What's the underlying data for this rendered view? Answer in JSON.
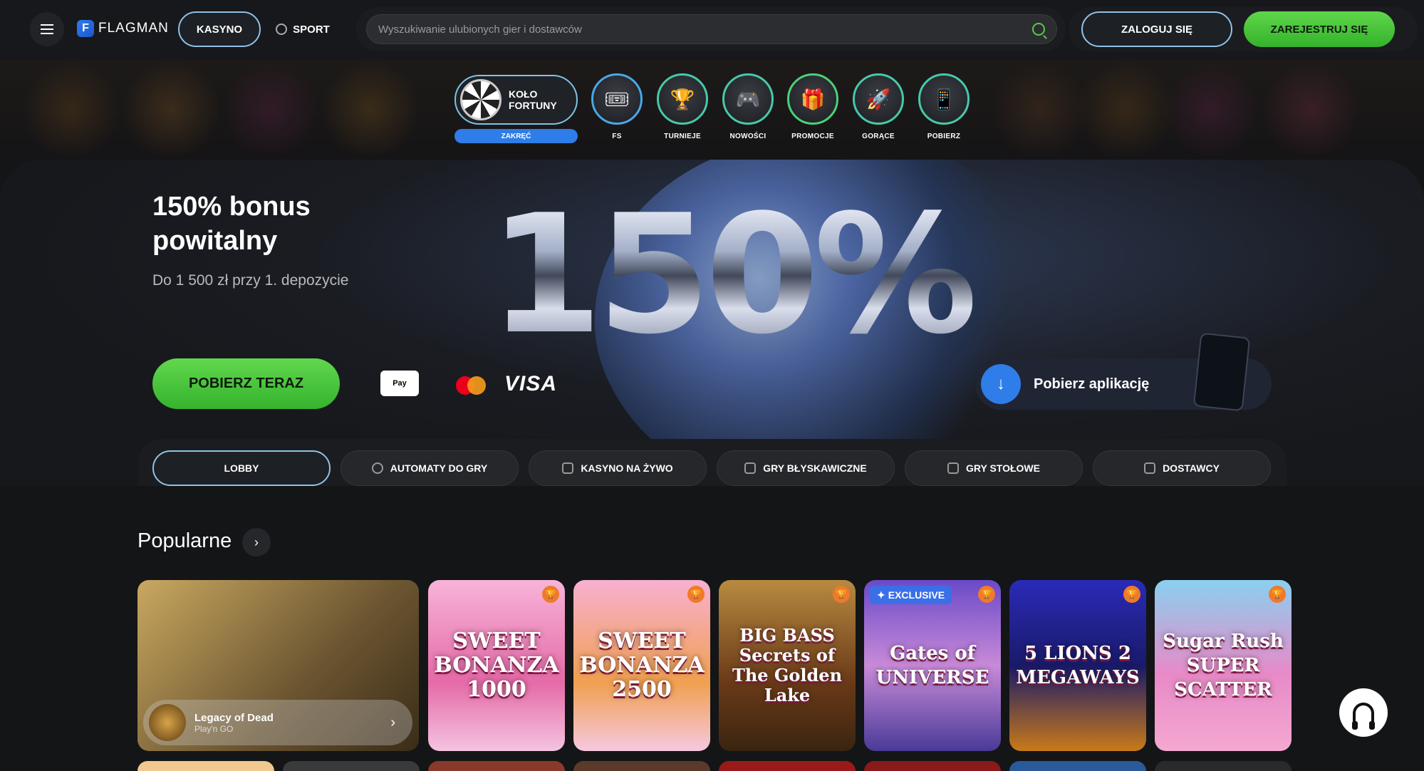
{
  "header": {
    "logo_text": "FLAGMAN",
    "nav": [
      {
        "label": "KASYNO"
      },
      {
        "label": "SPORT"
      }
    ],
    "search_placeholder": "Wyszukiwanie ulubionych gier i dostawców",
    "login_label": "ZALOGUJ SIĘ",
    "register_label": "ZAREJESTRUJ SIĘ"
  },
  "quick": {
    "wheel_label": "KOŁO FORTUNY",
    "wheel_spin": "ZAKRĘĆ",
    "items": [
      {
        "label": "FS",
        "icon": "ticket-icon"
      },
      {
        "label": "TURNIEJE",
        "icon": "trophy-icon"
      },
      {
        "label": "NOWOŚCI",
        "icon": "gamepad-icon"
      },
      {
        "label": "PROMOCJE",
        "icon": "gift-icon"
      },
      {
        "label": "GORĄCE",
        "icon": "rocket-icon"
      },
      {
        "label": "POBIERZ",
        "icon": "phone-icon"
      }
    ]
  },
  "hero": {
    "title": "150% bonus powitalny",
    "subtitle": "Do 1 500 zł przy 1. depozycie",
    "big_text": "150%",
    "cta": "POBIERZ TERAZ",
    "payments": {
      "apple": "Pay",
      "visa": "VISA"
    },
    "app_label": "Pobierz aplikację"
  },
  "categories": [
    {
      "label": "LOBBY"
    },
    {
      "label": "AUTOMATY DO GRY"
    },
    {
      "label": "KASYNO NA ŻYWO"
    },
    {
      "label": "GRY BŁYSKAWICZNE"
    },
    {
      "label": "GRY STOŁOWE"
    },
    {
      "label": "DOSTAWCY"
    }
  ],
  "popular": {
    "title": "Popularne",
    "featured": {
      "name": "Legacy of Dead",
      "provider": "Play'n GO"
    },
    "games": [
      {
        "title": "SWEET BONANZA 1000"
      },
      {
        "title": "SWEET BONANZA 2500"
      },
      {
        "title": "BIG BASS Secrets of The Golden Lake"
      },
      {
        "title": "Gates of UNIVERSE",
        "badge": "EXCLUSIVE"
      },
      {
        "title": "5 LIONS 2 MEGAWAYS"
      },
      {
        "title": "Sugar Rush SUPER SCATTER"
      }
    ]
  },
  "colors": {
    "accent_green": "#4fcf3f",
    "accent_blue": "#2f7de8",
    "outline_blue": "#8fc2e8"
  }
}
